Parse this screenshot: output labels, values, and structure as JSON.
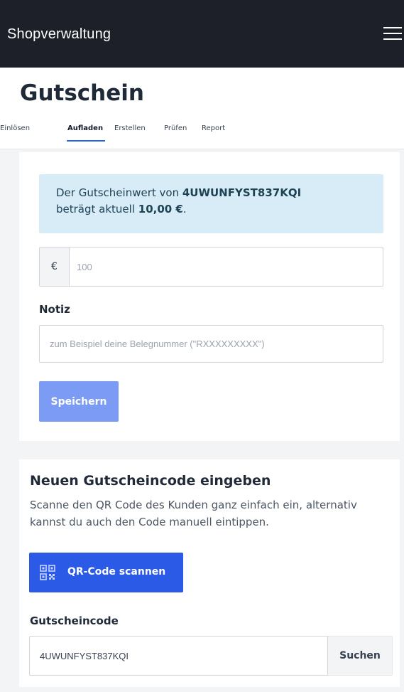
{
  "topbar": {
    "app_title": "Shopverwaltung",
    "menu_icon": "hamburger-menu-icon"
  },
  "header": {
    "page_title": "Gutschein",
    "tabs": [
      {
        "label": "Einlösen",
        "active": false
      },
      {
        "label": "Aufladen",
        "active": true
      },
      {
        "label": "Erstellen",
        "active": false
      },
      {
        "label": "Prüfen",
        "active": false
      },
      {
        "label": "Report",
        "active": false
      }
    ]
  },
  "topup": {
    "info_prefix": "Der Gutscheinwert von ",
    "info_code": "4UWUNFYST837KQI",
    "info_middle": "beträgt aktuell ",
    "info_value": "10,00 €",
    "info_suffix": ".",
    "currency_symbol": "€",
    "amount_placeholder": "100",
    "note_label": "Notiz",
    "note_placeholder": "zum Beispiel deine Belegnummer (\"RXXXXXXXXX\")",
    "save_label": "Speichern"
  },
  "code_entry": {
    "title": "Neuen Gutscheincode eingeben",
    "description": "Scanne den QR Code des Kunden ganz einfach ein, alternativ kannst du auch den Code manuell eintippen.",
    "qr_button_label": "QR-Code scannen",
    "qr_icon": "qr-code-icon",
    "code_label": "Gutscheincode",
    "code_value": "4UWUNFYST837KQI",
    "search_label": "Suchen"
  },
  "colors": {
    "topbar_bg": "#1d2029",
    "accent": "#2563eb",
    "info_bg": "#d7ecf7",
    "save_button": "#7b9bf5",
    "qr_button": "#2b5ae6"
  }
}
